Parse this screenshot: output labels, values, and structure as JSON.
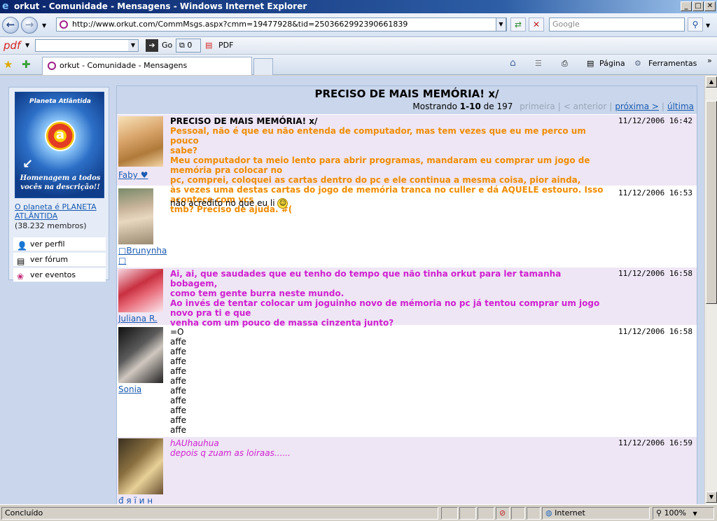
{
  "window": {
    "title": "orkut - Comunidade - Mensagens - Windows Internet Explorer"
  },
  "address": {
    "url": "http://www.orkut.com/CommMsgs.aspx?cmm=19477928&tid=2503662992390661839",
    "search_placeholder": "Google"
  },
  "pdfbar": {
    "logo": "pdf",
    "go_label": "Go",
    "counter": "0",
    "pdf_label": "PDF"
  },
  "tabs": {
    "active_label": "orkut - Comunidade - Mensagens"
  },
  "toolbar": {
    "pagina": "Página",
    "ferramentas": "Ferramentas"
  },
  "community": {
    "image_caption": "Homenagem a todos vocês na descrição!!",
    "image_logo": "Planeta Atlântida",
    "name": "O planeta é PLANETA ATLÂNTIDA",
    "members": "(38.232 membros)",
    "links": [
      "ver perfil",
      "ver fórum",
      "ver eventos"
    ]
  },
  "board": {
    "title": "PRECISO DE MAIS MEMÓRIA! x/",
    "paging": {
      "showing": "Mostrando",
      "range": "1-10",
      "of": "de 197",
      "first": "primeira",
      "prev": "< anterior",
      "next": "próxima >",
      "last": "última"
    }
  },
  "posts": [
    {
      "author": "Faby ♥",
      "time": "11/12/2006 16:42",
      "title": "PRECISO DE MAIS MEMÓRIA! x/",
      "lines": [
        "Pessoal, não é que eu não entenda de computador, mas tem vezes que eu me perco um pouco",
        "sabe?",
        "Meu computador ta meio lento para abrir programas, mandaram eu comprar um jogo de memória pra colocar no",
        "pc, comprei, coloquei as cartas dentro do pc e ele continua a mesma coisa, pior ainda,",
        "às vezes uma destas cartas do jogo de memória tranca no culler e dá AQUELE estouro. Isso acontece com vcs",
        "tmb? Preciso de ajuda. #("
      ]
    },
    {
      "author": "□Brunynha □",
      "time": "11/12/2006 16:53",
      "lines": [
        "não acredito no que eu li"
      ]
    },
    {
      "author": "Juliana R.",
      "time": "11/12/2006 16:58",
      "lines": [
        "Ai, ai, que saudades que eu tenho do tempo que não tinha orkut para ler tamanha bobagem,",
        "como tem gente burra neste mundo.",
        "Ao invés de tentar colocar um joguinho novo de mémoria no pc já tentou comprar um jogo novo pra ti e que",
        "venha com um pouco de massa cinzenta junto?"
      ]
    },
    {
      "author": "Sonia",
      "time": "11/12/2006 16:58",
      "lines": [
        "=O",
        "affe",
        "affe",
        "affe",
        "affe",
        "affe",
        "affe",
        "affe",
        "affe",
        "affe",
        "affe"
      ]
    },
    {
      "author": "đ я ї и н",
      "time": "11/12/2006 16:59",
      "lines": [
        "hAUhauhua",
        "",
        "",
        "depois q zuam as loiraas......"
      ]
    }
  ],
  "status": {
    "text": "Concluído",
    "zone": "Internet",
    "zoom": "100%"
  }
}
